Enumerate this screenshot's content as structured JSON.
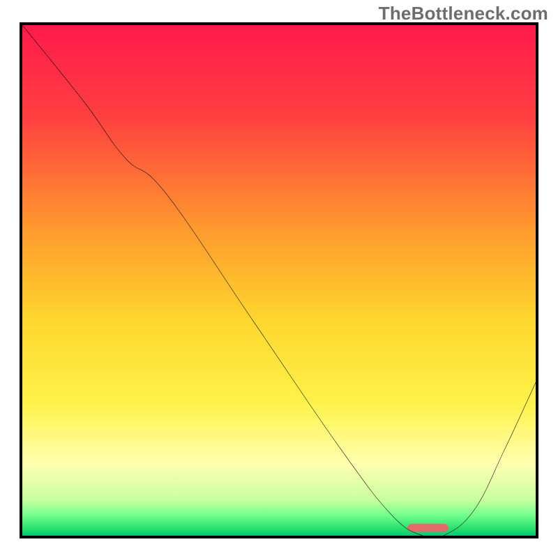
{
  "watermark": "TheBottleneck.com",
  "chart_data": {
    "type": "line",
    "title": "",
    "xlabel": "",
    "ylabel": "",
    "xlim": [
      0,
      100
    ],
    "ylim": [
      0,
      100
    ],
    "grid": false,
    "legend": false,
    "gradient_stops": [
      {
        "offset": 0,
        "color": "#ff1a4b"
      },
      {
        "offset": 18,
        "color": "#ff4040"
      },
      {
        "offset": 40,
        "color": "#ff9a2e"
      },
      {
        "offset": 58,
        "color": "#ffd72e"
      },
      {
        "offset": 74,
        "color": "#fff24a"
      },
      {
        "offset": 86,
        "color": "#ffffb0"
      },
      {
        "offset": 93,
        "color": "#c9ff9f"
      },
      {
        "offset": 96,
        "color": "#73ff8c"
      },
      {
        "offset": 99,
        "color": "#1edb6b"
      },
      {
        "offset": 100,
        "color": "#00c97a"
      }
    ],
    "curve": {
      "x": [
        0,
        12,
        20,
        28,
        45,
        62,
        72,
        78,
        82,
        88,
        94,
        100
      ],
      "values": [
        100,
        85,
        74,
        67,
        42,
        17,
        4,
        0,
        0,
        5,
        17,
        30
      ]
    },
    "marker": {
      "x_start": 75,
      "x_end": 83,
      "y": 0.7,
      "height": 1.6,
      "color": "#e16a6a",
      "radius": 0.9
    }
  }
}
